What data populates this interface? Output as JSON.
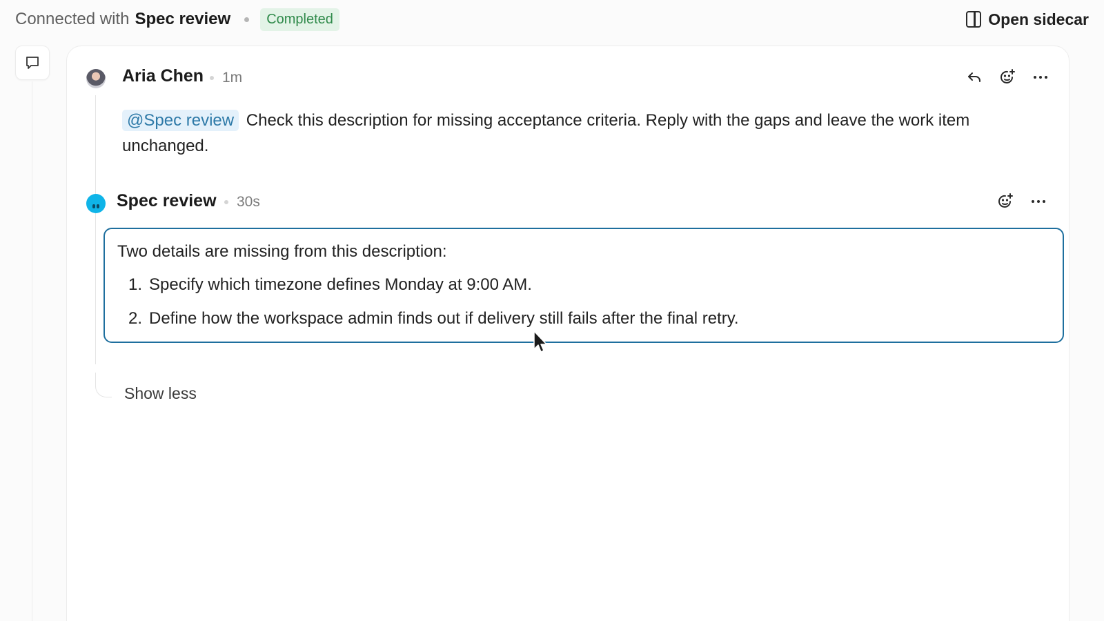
{
  "header": {
    "connected_prefix": "Connected with",
    "connected_name": "Spec review",
    "status_badge": "Completed",
    "open_sidecar_label": "Open sidecar"
  },
  "comments": [
    {
      "author": "Aria Chen",
      "time": "1m",
      "mention": "@Spec review",
      "text": "Check this description for missing acceptance criteria. Reply with the gaps and leave the work item unchanged."
    },
    {
      "author": "Spec review",
      "time": "30s",
      "intro": "Two details are missing from this description:",
      "items": [
        {
          "num": "1.",
          "text": "Specify which timezone defines Monday at 9:00 AM."
        },
        {
          "num": "2.",
          "text": "Define how the workspace admin finds out if delivery still fails after the final retry."
        }
      ]
    }
  ],
  "thread": {
    "show_less_label": "Show less"
  },
  "icons": {
    "rail": "comment-icon",
    "reply": "reply-icon",
    "reaction": "add-reaction-icon",
    "more": "more-icon",
    "sidecar": "sidebar-panel-icon"
  },
  "colors": {
    "accent": "#1e6f9e",
    "mention_text": "#2e7aa8",
    "mention_bg": "#e4f1fb",
    "badge_text": "#2f8a4a",
    "badge_bg": "#e3f3e7",
    "agent_avatar": "#0fb4e8"
  }
}
